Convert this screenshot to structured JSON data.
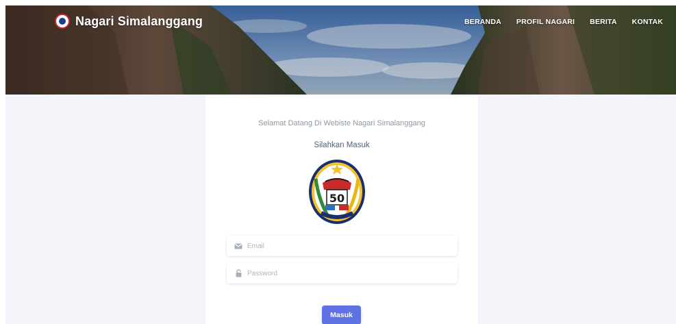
{
  "brand": {
    "name": "Nagari Simalanggang",
    "logo_icon": "nagari-logo-icon"
  },
  "nav": {
    "items": [
      {
        "label": "BERANDA"
      },
      {
        "label": "PROFIL NAGARI"
      },
      {
        "label": "BERITA"
      },
      {
        "label": "KONTAK"
      }
    ]
  },
  "login": {
    "welcome": "Selamat Datang Di Webiste Nagari Simalanggang",
    "subtitle": "Silahkan Masuk",
    "emblem_icon": "regency-emblem-icon",
    "emblem_text": "50",
    "email": {
      "placeholder": "Email",
      "value": "",
      "icon": "envelope-icon"
    },
    "password": {
      "placeholder": "Password",
      "value": "",
      "icon": "lock-icon"
    },
    "submit_label": "Masuk"
  },
  "colors": {
    "primary": "#5e72e4",
    "background": "#f4f5fb",
    "text_muted": "#8c98a4"
  }
}
